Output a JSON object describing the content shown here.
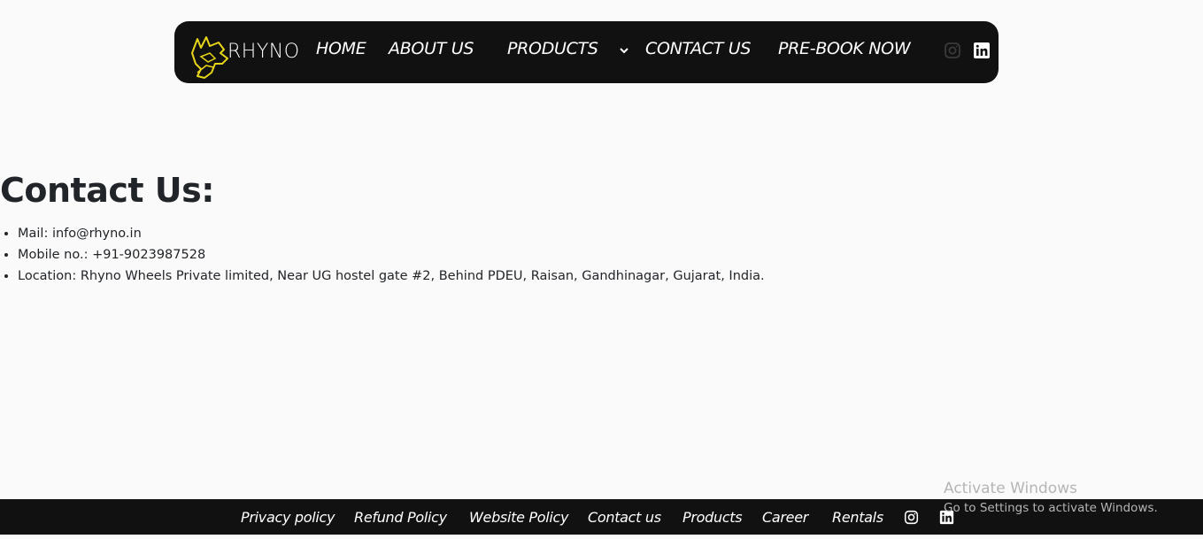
{
  "brand": {
    "logo_text": "RHYNO",
    "accent": "#e8d51a"
  },
  "nav": {
    "home": "HOME",
    "about": "ABOUT US",
    "products": "PRODUCTS",
    "contact": "CONTACT US",
    "prebook": "PRE-BOOK NOW",
    "icons": [
      "instagram-icon",
      "linkedin-icon"
    ]
  },
  "main": {
    "title": "Contact Us:",
    "items": [
      "Mail: info@rhyno.in",
      "Mobile no.: +91-9023987528",
      "Location: Rhyno Wheels Private limited, Near UG hostel gate #2, Behind PDEU, Raisan, Gandhinagar, Gujarat, India."
    ]
  },
  "footer": {
    "links": [
      "Privacy policy",
      "Refund Policy",
      "Website Policy",
      "Contact us",
      "Products",
      "Career",
      "Rentals"
    ],
    "icons": [
      "instagram-icon",
      "linkedin-icon"
    ]
  },
  "watermark": {
    "line1": "Activate Windows",
    "line2": "Go to Settings to activate Windows."
  },
  "colors": {
    "nav_bg": "#111111",
    "page_bg": "#fafafa",
    "text": "#212529",
    "link": "#ffffff"
  }
}
